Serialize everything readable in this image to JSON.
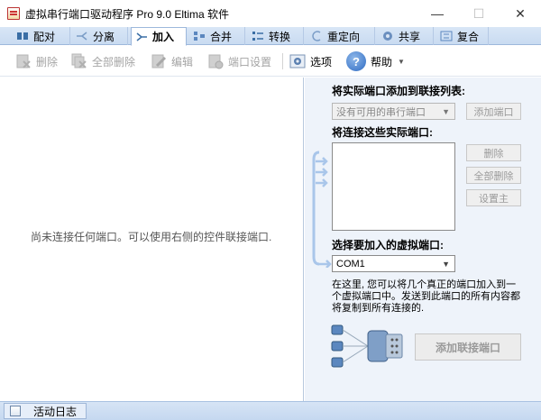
{
  "window": {
    "title": "虚拟串行端口驱动程序 Pro 9.0 Eltima 软件",
    "minimize_glyph": "—",
    "maximize_glyph": "☐",
    "close_glyph": "✕"
  },
  "tabs": [
    {
      "label": "配对",
      "icon": "pair-icon",
      "active": false
    },
    {
      "label": "分离",
      "icon": "split-icon",
      "active": false
    },
    {
      "label": "加入",
      "icon": "join-icon",
      "active": true
    },
    {
      "label": "合并",
      "icon": "merge-icon",
      "active": false
    },
    {
      "label": "转换",
      "icon": "convert-icon",
      "active": false
    },
    {
      "label": "重定向",
      "icon": "redirect-icon",
      "active": false
    },
    {
      "label": "共享",
      "icon": "share-icon",
      "active": false
    },
    {
      "label": "复合",
      "icon": "composite-icon",
      "active": false
    }
  ],
  "toolbar": {
    "delete_label": "删除",
    "delete_all_label": "全部删除",
    "edit_label": "编辑",
    "port_settings_label": "端口设置",
    "options_label": "选项",
    "help_label": "帮助",
    "help_glyph": "?"
  },
  "left": {
    "empty_message": "尚未连接任何端口。可以使用右侧的控件联接端口."
  },
  "right": {
    "add_to_list_label": "将实际端口添加到联接列表:",
    "available_ports_value": "没有可用的串行端口",
    "add_port_button": "添加端口",
    "connect_ports_label": "将连接这些实际端口:",
    "delete_button": "删除",
    "delete_all_button": "全部删除",
    "set_master_button": "设置主",
    "select_virtual_label": "选择要加入的虚拟端口:",
    "virtual_port_value": "COM1",
    "description_lines": [
      "在这里, 您可以将几个真正的端口加入到一",
      "个虚拟端口中。发送到此端口的所有内容都",
      "将复制到所有连接的."
    ],
    "add_join_button": "添加联接端口"
  },
  "statusbar": {
    "activity_log_label": "活动日志"
  },
  "colors": {
    "tab_bar": "#c9dbf1",
    "right_panel": "#eef3fa",
    "accent_blue": "#2e6bc2",
    "disabled_text": "#9a9a9a"
  }
}
